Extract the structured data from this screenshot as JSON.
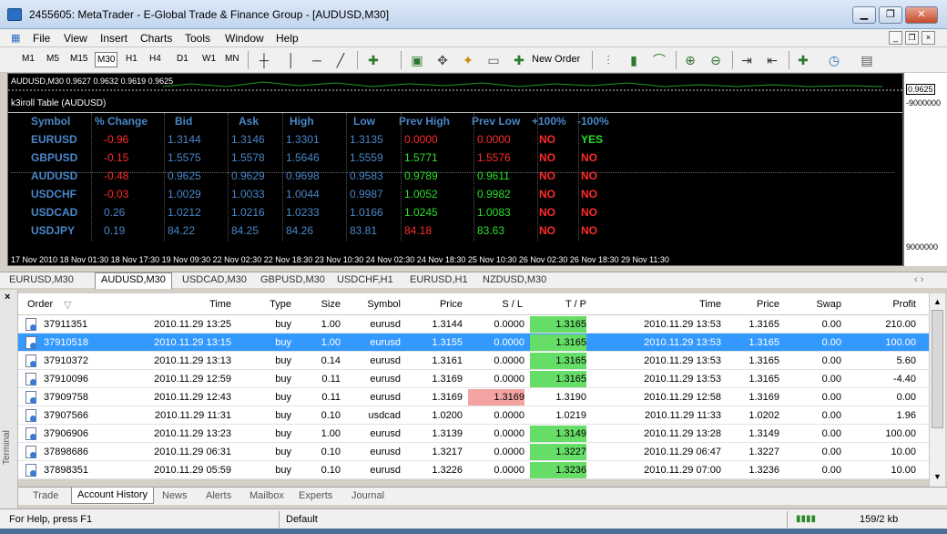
{
  "window": {
    "title": "2455605: MetaTrader - E-Global Trade & Finance Group - [AUDUSD,M30]",
    "minimize": "▁",
    "maximize": "❐",
    "close": "✕"
  },
  "menu": [
    "File",
    "View",
    "Insert",
    "Charts",
    "Tools",
    "Window",
    "Help"
  ],
  "mdi": {
    "minimize": "_",
    "restore": "❐",
    "close": "×"
  },
  "timeframes": [
    "M1",
    "M5",
    "M15",
    "M30",
    "H1",
    "H4",
    "D1",
    "W1",
    "MN"
  ],
  "active_timeframe": "M30",
  "toolbar": {
    "new_order": "New Order"
  },
  "chart": {
    "header": "AUDUSD,M30  0.9627 0.9632 0.9619 0.9625",
    "price_top": "0.9625",
    "price_mid": "-9000000",
    "price_bottom": "9000000",
    "indicator_title": "k3iroll Table (AUDUSD)",
    "headers": [
      "Symbol",
      "% Change",
      "Bid",
      "Ask",
      "High",
      "Low",
      "Prev High",
      "Prev Low",
      "+100%",
      "-100%"
    ],
    "rows": [
      [
        "EURUSD",
        "-0.96",
        "1.3144",
        "1.3146",
        "1.3301",
        "1.3135",
        "0.0000",
        "0.0000",
        "NO",
        "YES"
      ],
      [
        "GBPUSD",
        "-0.15",
        "1.5575",
        "1.5578",
        "1.5646",
        "1.5559",
        "1.5771",
        "1.5576",
        "NO",
        "NO"
      ],
      [
        "AUDUSD",
        "-0.48",
        "0.9625",
        "0.9629",
        "0.9698",
        "0.9583",
        "0.9789",
        "0.9611",
        "NO",
        "NO"
      ],
      [
        "USDCHF",
        "-0.03",
        "1.0029",
        "1.0033",
        "1.0044",
        "0.9987",
        "1.0052",
        "0.9982",
        "NO",
        "NO"
      ],
      [
        "USDCAD",
        "0.26",
        "1.0212",
        "1.0216",
        "1.0233",
        "1.0166",
        "1.0245",
        "1.0083",
        "NO",
        "NO"
      ],
      [
        "USDJPY",
        "0.19",
        "84.22",
        "84.25",
        "84.26",
        "83.81",
        "84.18",
        "83.63",
        "NO",
        "NO"
      ]
    ],
    "time_axis": "17 Nov 2010   18 Nov 01:30  18 Nov 17:30  19 Nov 09:30  22 Nov 02:30  22 Nov 18:30  23 Nov 10:30  24 Nov 02:30  24 Nov 18:30  25 Nov 10:30  26 Nov 02:30  26 Nov 18:30  29 Nov 11:30"
  },
  "chart_tabs": [
    "EURUSD,M30",
    "AUDUSD,M30",
    "USDCAD,M30",
    "GBPUSD,M30",
    "USDCHF,H1",
    "EURUSD,H1",
    "NZDUSD,M30"
  ],
  "active_chart_tab": "AUDUSD,M30",
  "grid": {
    "headers": [
      "Order",
      "Time",
      "Type",
      "Size",
      "Symbol",
      "Price",
      "S / L",
      "T / P",
      "Time",
      "Price",
      "Swap",
      "Profit"
    ],
    "rows": [
      [
        "37911351",
        "2010.11.29 13:25",
        "buy",
        "1.00",
        "eurusd",
        "1.3144",
        "0.0000",
        "1.3165",
        "2010.11.29 13:53",
        "1.3165",
        "0.00",
        "210.00"
      ],
      [
        "37910518",
        "2010.11.29 13:15",
        "buy",
        "1.00",
        "eurusd",
        "1.3155",
        "0.0000",
        "1.3165",
        "2010.11.29 13:53",
        "1.3165",
        "0.00",
        "100.00"
      ],
      [
        "37910372",
        "2010.11.29 13:13",
        "buy",
        "0.14",
        "eurusd",
        "1.3161",
        "0.0000",
        "1.3165",
        "2010.11.29 13:53",
        "1.3165",
        "0.00",
        "5.60"
      ],
      [
        "37910096",
        "2010.11.29 12:59",
        "buy",
        "0.11",
        "eurusd",
        "1.3169",
        "0.0000",
        "1.3165",
        "2010.11.29 13:53",
        "1.3165",
        "0.00",
        "-4.40"
      ],
      [
        "37909758",
        "2010.11.29 12:43",
        "buy",
        "0.11",
        "eurusd",
        "1.3169",
        "1.3169",
        "1.3190",
        "2010.11.29 12:58",
        "1.3169",
        "0.00",
        "0.00"
      ],
      [
        "37907566",
        "2010.11.29 11:31",
        "buy",
        "0.10",
        "usdcad",
        "1.0200",
        "0.0000",
        "1.0219",
        "2010.11.29 11:33",
        "1.0202",
        "0.00",
        "1.96"
      ],
      [
        "37906906",
        "2010.11.29 13:23",
        "buy",
        "1.00",
        "eurusd",
        "1.3139",
        "0.0000",
        "1.3149",
        "2010.11.29 13:28",
        "1.3149",
        "0.00",
        "100.00"
      ],
      [
        "37898686",
        "2010.11.29 06:31",
        "buy",
        "0.10",
        "eurusd",
        "1.3217",
        "0.0000",
        "1.3227",
        "2010.11.29 06:47",
        "1.3227",
        "0.00",
        "10.00"
      ],
      [
        "37898351",
        "2010.11.29 05:59",
        "buy",
        "0.10",
        "eurusd",
        "1.3226",
        "0.0000",
        "1.3236",
        "2010.11.29 07:00",
        "1.3236",
        "0.00",
        "10.00"
      ]
    ]
  },
  "terminal_label": "Terminal",
  "bottom_tabs": [
    "Trade",
    "Account History",
    "News",
    "Alerts",
    "Mailbox",
    "Experts",
    "Journal"
  ],
  "active_bottom_tab": "Account History",
  "status": {
    "help": "For Help, press F1",
    "profile": "Default",
    "traffic": "159/2 kb"
  }
}
